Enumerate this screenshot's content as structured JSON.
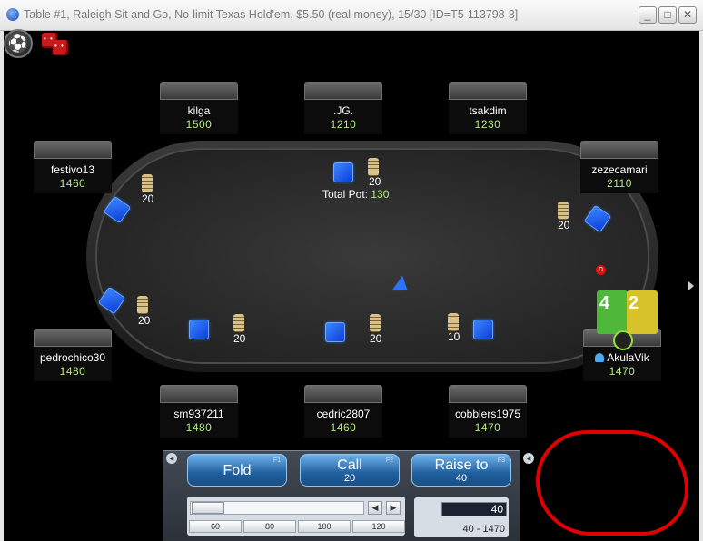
{
  "window": {
    "title": "Table #1, Raleigh Sit and Go, No-limit Texas Hold'em, $5.50 (real money), 15/30 [ID=T5-113798-3]",
    "minimize": "_",
    "maximize": "□",
    "close": "✕"
  },
  "seats": {
    "kilga": {
      "name": "kilga",
      "stack": "1500"
    },
    "jg": {
      "name": ".JG.",
      "stack": "1210"
    },
    "tsakdim": {
      "name": "tsakdim",
      "stack": "1230"
    },
    "festivo": {
      "name": "festivo13",
      "stack": "1460"
    },
    "zeze": {
      "name": "zezecamari",
      "stack": "2110"
    },
    "pedro": {
      "name": "pedrochico30",
      "stack": "1480"
    },
    "akula": {
      "name": "AkulaVik",
      "stack": "1470"
    },
    "sm": {
      "name": "sm937211",
      "stack": "1480"
    },
    "cedric": {
      "name": "cedric2807",
      "stack": "1460"
    },
    "cobblers": {
      "name": "cobblers1975",
      "stack": "1470"
    }
  },
  "bets": {
    "jg": "20",
    "festivo": "20",
    "zeze": "20",
    "pedro": "20",
    "sm": "20",
    "cedric": "20",
    "cobblers": "10"
  },
  "pot": {
    "label": "Total Pot:",
    "value": "130"
  },
  "dealer_button": "D",
  "hero_cards": [
    "4",
    "2"
  ],
  "actions": {
    "fold": {
      "label": "Fold",
      "key": "F1"
    },
    "call": {
      "label": "Call",
      "amount": "20",
      "key": "F2"
    },
    "raise": {
      "label": "Raise to",
      "amount": "40",
      "key": "F3"
    }
  },
  "slider": {
    "presets": [
      "60",
      "80",
      "100",
      "120"
    ],
    "value": "40",
    "range": "40 - 1470"
  }
}
